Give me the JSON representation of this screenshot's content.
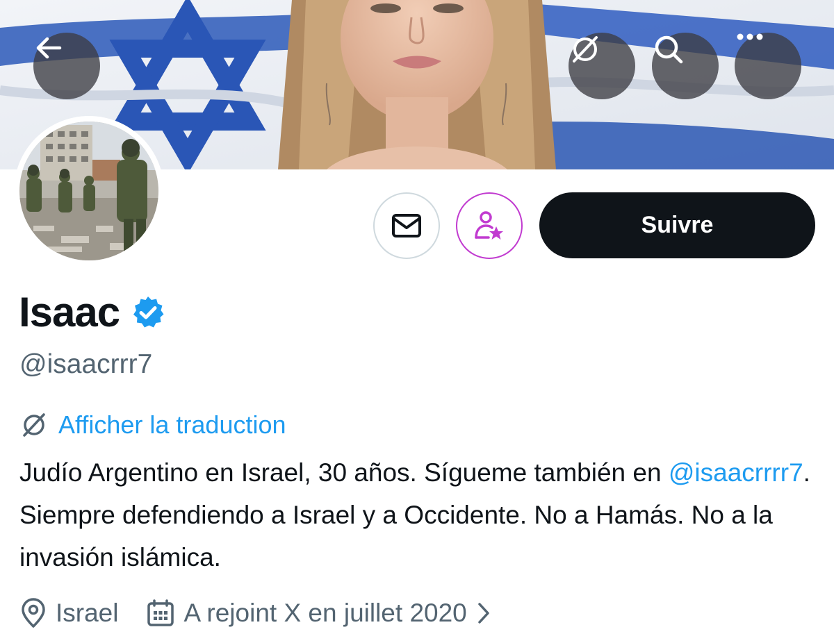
{
  "header": {
    "back_icon": "arrow-left-icon",
    "translate_icon": "translate-icon",
    "search_icon": "search-icon",
    "more_icon": "more-horizontal-icon"
  },
  "profile": {
    "display_name": "Isaac",
    "verified": true,
    "handle": "@isaacrrr7"
  },
  "actions": {
    "message_icon": "envelope-icon",
    "subscribe_icon": "person-star-icon",
    "follow_label": "Suivre"
  },
  "translate": {
    "label": "Afficher la traduction"
  },
  "bio": {
    "part1": "Judío Argentino en Israel, 30 años. Sígueme también en ",
    "mention": "@isaacrrrr7",
    "part2": ". Siempre defendiendo a Israel y a Occidente. No a Hamás. No a la invasión islámica."
  },
  "meta": {
    "location": "Israel",
    "joined": "A rejoint X en juillet 2020"
  },
  "colors": {
    "link": "#1d9bf0",
    "verified": "#1d9bf0",
    "follow_bg": "#0f1419",
    "subscribe_accent": "#c13bd0",
    "secondary_text": "#536471"
  }
}
